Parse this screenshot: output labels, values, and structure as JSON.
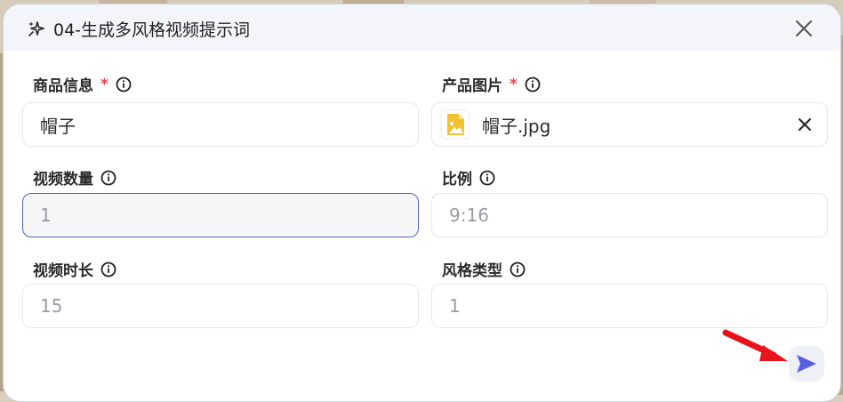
{
  "dialog": {
    "title": "04-生成多风格视频提示词",
    "title_icon": "sparkle-icon",
    "close_icon": "close-icon"
  },
  "fields": {
    "product_info": {
      "label": "商品信息",
      "required_mark": "*",
      "value": "帽子"
    },
    "product_image": {
      "label": "产品图片",
      "required_mark": "*",
      "file_name": "帽子.jpg",
      "file_icon": "image-file-icon"
    },
    "video_count": {
      "label": "视频数量",
      "placeholder": "1"
    },
    "ratio": {
      "label": "比例",
      "placeholder": "9:16"
    },
    "video_duration": {
      "label": "视频时长",
      "placeholder": "15"
    },
    "style_type": {
      "label": "风格类型",
      "placeholder": "1"
    }
  },
  "send_icon": "send-icon",
  "colors": {
    "accent": "#5561c8",
    "required": "#e5484d",
    "header_bg": "#f4f5fa",
    "file_icon": "#f2c232",
    "annotation_arrow": "#e8141b"
  }
}
